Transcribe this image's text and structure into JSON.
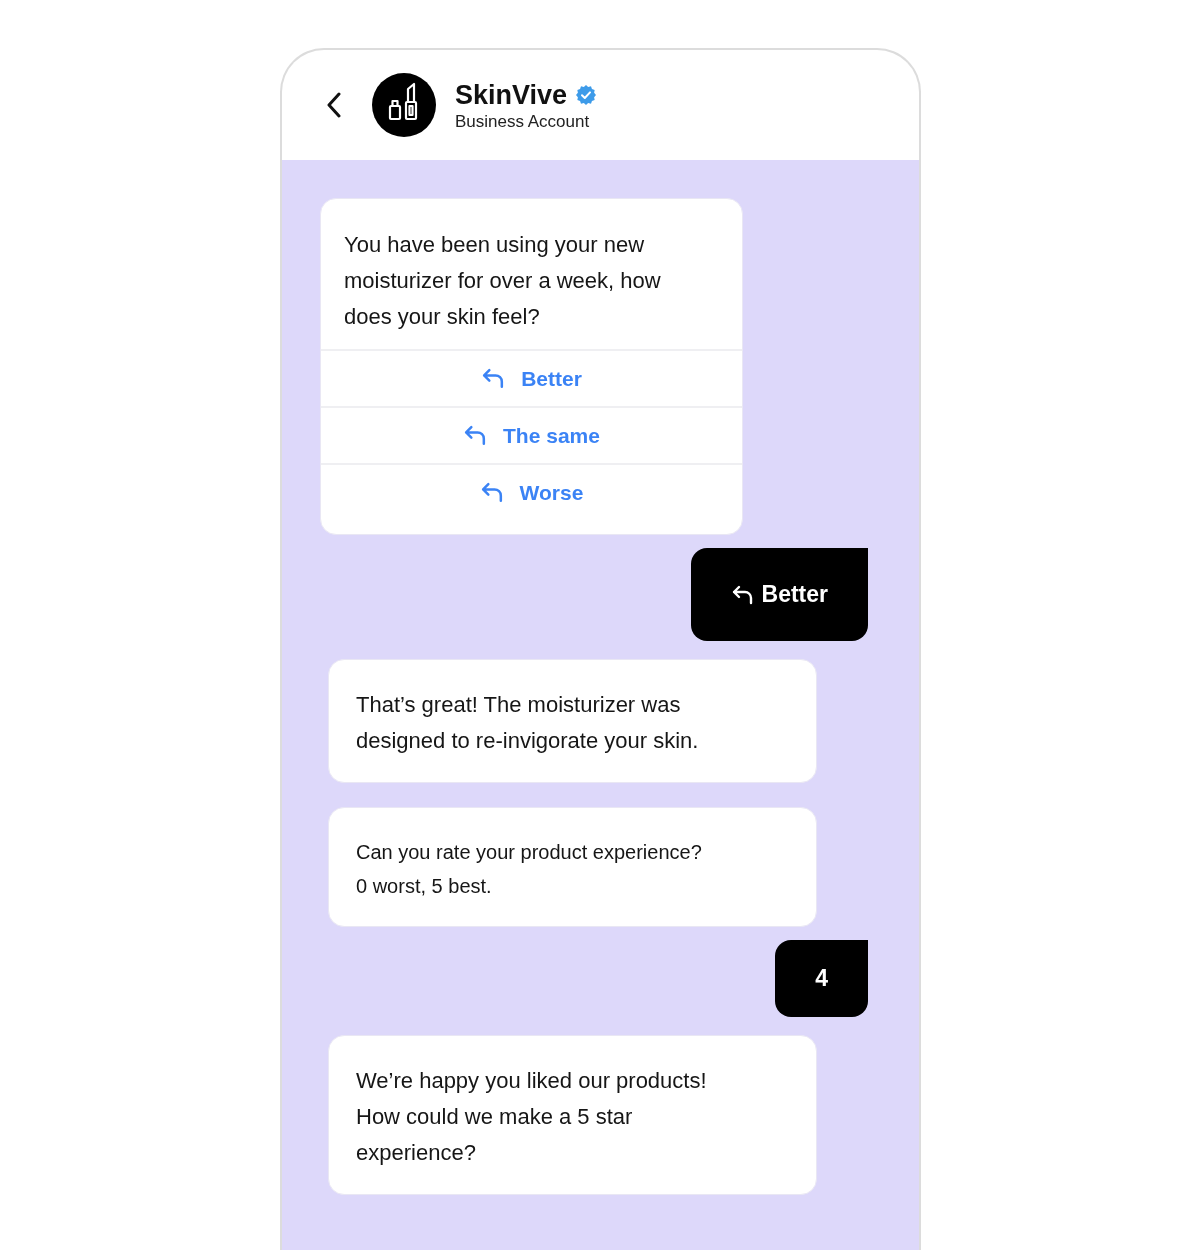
{
  "header": {
    "title": "SkinVive",
    "verified": true,
    "subtitle": "Business Account"
  },
  "messages": [
    {
      "outgoing": false,
      "kind": "quick_replies",
      "text": "You have been using your new\nmoisturizer for over a week, how\ndoes your skin feel?",
      "options": [
        {
          "label": "Better"
        },
        {
          "label": "The same"
        },
        {
          "label": "Worse"
        }
      ]
    },
    {
      "outgoing": true,
      "kind": "quick_reply_answer",
      "text": "Better"
    },
    {
      "outgoing": false,
      "kind": "text",
      "text": "That’s great! The moisturizer was\ndesigned to re-invigorate your skin."
    },
    {
      "outgoing": false,
      "kind": "prompt",
      "text": "Can you rate your product experience?\n0 worst, 5 best."
    },
    {
      "outgoing": true,
      "kind": "text",
      "text": "4"
    },
    {
      "outgoing": false,
      "kind": "text",
      "text": "We’re happy you liked our products!\nHow could we make a 5 star\nexperience?"
    }
  ]
}
